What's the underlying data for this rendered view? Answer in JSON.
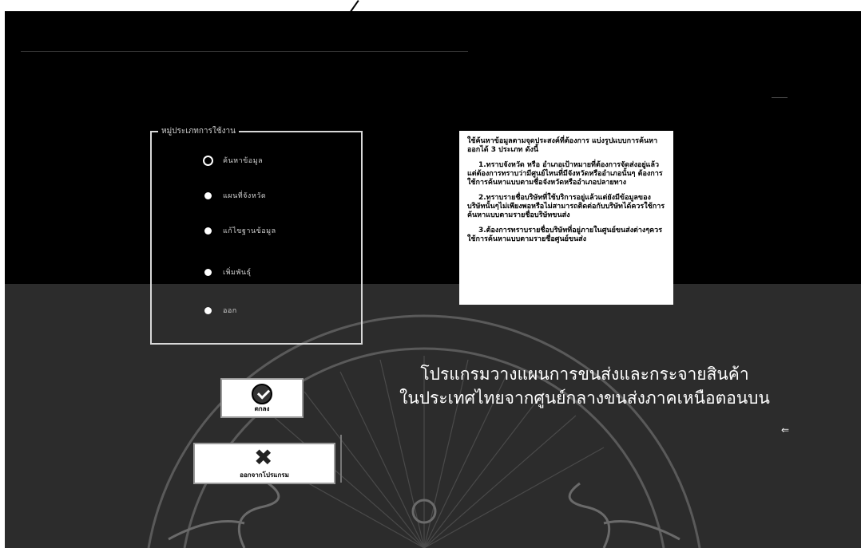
{
  "options_group": {
    "legend": "หมู่ประเภทการใช้งาน",
    "options": [
      {
        "label": "ค้นหาข้อมูล",
        "selected": true
      },
      {
        "label": "แผนที่จังหวัด",
        "selected": false
      },
      {
        "label": "แก้ไขฐานข้อมูล",
        "selected": false
      },
      {
        "label": "เพิ่มพันธุ์",
        "selected": false
      },
      {
        "label": "ออก",
        "selected": false
      }
    ]
  },
  "info": {
    "paragraphs": [
      "ใช้ค้นหาข้อมูลตามจุดประสงค์ที่ต้องการ แบ่งรูปแบบการค้นหาออกได้ 3 ประเภท ดังนี้",
      "1.ทราบจังหวัด หรือ อำเภอเป้าหมายที่ต้องการจัดส่งอยู่แล้วแต่ต้องการทราบว่ามีศูนย์ไหนที่มีจังหวัดหรืออำเภอนั้นๆ ต้องการใช้การค้นหาแบบตามชื่อจังหวัดหรืออำเภอปลายทาง",
      "2.ทราบรายชื่อบริษัทที่ใช้บริการอยู่แล้วแต่ยังมีข้อมูลของบริษัทนั้นๆไม่เพียงพอหรือไม่สามารถติดต่อกับบริษัทได้ควรใช้การค้นหาแบบตามรายชื่อบริษัทขนส่ง",
      "3.ต้องการทราบรายชื่อบริษัทที่อยู่ภายในศูนย์ขนส่งต่างๆควรใช้การค้นหาแบบตามรายชื่อศูนย์ขนส่ง"
    ]
  },
  "title": {
    "line1": "โปรแกรมวางแผนการขนส่งและกระจายสินค้า",
    "line2": "ในประเทศไทยจากศูนย์กลางขนส่งภาคเหนือตอนบน"
  },
  "buttons": {
    "ok_label": "ตกลง",
    "exit_label": "ออกจากโปรแกรม"
  },
  "colors": {
    "panel_dark": "#000000",
    "panel_gray": "#2c2c2c",
    "text_light": "#ffffff"
  }
}
